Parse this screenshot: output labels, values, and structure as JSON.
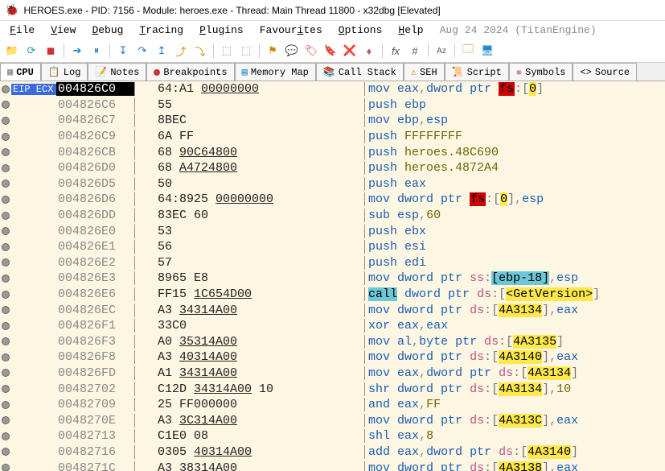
{
  "title": "HEROES.exe - PID: 7156 - Module: heroes.exe - Thread: Main Thread 11800 - x32dbg [Elevated]",
  "menu": {
    "file": "File",
    "view": "View",
    "debug": "Debug",
    "tracing": "Tracing",
    "plugins": "Plugins",
    "favourites": "Favourites",
    "options": "Options",
    "help": "Help",
    "date_info": "Aug 24 2024 (TitanEngine)"
  },
  "tabs": {
    "cpu": "CPU",
    "log": "Log",
    "notes": "Notes",
    "breakpoints": "Breakpoints",
    "memory_map": "Memory Map",
    "call_stack": "Call Stack",
    "seh": "SEH",
    "script": "Script",
    "symbols": "Symbols",
    "source": "Source"
  },
  "eip_label": "EIP ECX",
  "rows": [
    {
      "eip": true,
      "addr": "004826C0",
      "bytes_pre": "64:A1 ",
      "bytes_u": "00000000",
      "disasm_html": "<span class='mn'>mov</span> <span class='reg'>eax</span><span class='gray'>,</span><span class='mn'>dword ptr</span> <span class='seg-fs'>fs</span><span class='bracket'>:</span><span class='bracket'>[</span><span class='br-y'>0</span><span class='bracket'>]</span>"
    },
    {
      "addr": "004826C6",
      "bytes_pre": "55",
      "disasm_html": "<span class='mn'>push</span> <span class='reg'>ebp</span>"
    },
    {
      "addr": "004826C7",
      "bytes_pre": "8BEC",
      "disasm_html": "<span class='mn'>mov</span> <span class='reg'>ebp</span><span class='gray'>,</span><span class='reg'>esp</span>"
    },
    {
      "addr": "004826C9",
      "bytes_pre": "6A FF",
      "disasm_html": "<span class='mn'>push</span> <span class='num'>FFFFFFFF</span>"
    },
    {
      "addr": "004826CB",
      "bytes_pre": "68 ",
      "bytes_u": "90C64800",
      "disasm_html": "<span class='mn'>push</span> <span class='num'>heroes.48C690</span>"
    },
    {
      "addr": "004826D0",
      "bytes_pre": "68 ",
      "bytes_u": "A4724800",
      "disasm_html": "<span class='mn'>push</span> <span class='num'>heroes.4872A4</span>"
    },
    {
      "addr": "004826D5",
      "bytes_pre": "50",
      "disasm_html": "<span class='mn'>push</span> <span class='reg'>eax</span>"
    },
    {
      "addr": "004826D6",
      "bytes_pre": "64:8925 ",
      "bytes_u": "00000000",
      "disasm_html": "<span class='mn'>mov</span> <span class='mn'>dword ptr</span> <span class='seg-fs'>fs</span><span class='bracket'>:</span><span class='bracket'>[</span><span class='br-y'>0</span><span class='bracket'>]</span><span class='gray'>,</span><span class='reg'>esp</span>"
    },
    {
      "addr": "004826DD",
      "bytes_pre": "83EC 60",
      "disasm_html": "<span class='mn'>sub</span> <span class='reg'>esp</span><span class='gray'>,</span><span class='num'>60</span>"
    },
    {
      "addr": "004826E0",
      "bytes_pre": "53",
      "disasm_html": "<span class='mn'>push</span> <span class='reg'>ebx</span>"
    },
    {
      "addr": "004826E1",
      "bytes_pre": "56",
      "disasm_html": "<span class='mn'>push</span> <span class='reg'>esi</span>"
    },
    {
      "addr": "004826E2",
      "bytes_pre": "57",
      "disasm_html": "<span class='mn'>push</span> <span class='reg'>edi</span>"
    },
    {
      "addr": "004826E3",
      "bytes_pre": "8965 E8",
      "disasm_html": "<span class='mn'>mov</span> <span class='mn'>dword ptr</span> <span class='seg-ss'>ss</span><span class='bracket'>:</span><span class='call-bg'>[</span><span class='call-bg'>ebp-18</span><span class='call-bg'>]</span><span class='gray'>,</span><span class='reg'>esp</span>"
    },
    {
      "addr": "004826E6",
      "bytes_pre": "FF15 ",
      "bytes_u": "1C654D00",
      "disasm_html": "<span class='call-bg'>call</span> <span class='mn'>dword ptr</span> <span class='seg-ds'>ds</span><span class='bracket'>:</span><span class='bracket'>[</span><span class='ptr-hl'>&lt;GetVersion&gt;</span><span class='bracket'>]</span>"
    },
    {
      "addr": "004826EC",
      "bytes_pre": "A3 ",
      "bytes_u": "34314A00",
      "disasm_html": "<span class='mn'>mov</span> <span class='mn'>dword ptr</span> <span class='seg-ds'>ds</span><span class='bracket'>:</span><span class='bracket'>[</span><span class='ptr-hl'>4A3134</span><span class='bracket'>]</span><span class='gray'>,</span><span class='reg'>eax</span>"
    },
    {
      "addr": "004826F1",
      "bytes_pre": "33C0",
      "disasm_html": "<span class='mn'>xor</span> <span class='reg'>eax</span><span class='gray'>,</span><span class='reg'>eax</span>"
    },
    {
      "addr": "004826F3",
      "bytes_pre": "A0 ",
      "bytes_u": "35314A00",
      "disasm_html": "<span class='mn'>mov</span> <span class='reg'>al</span><span class='gray'>,</span><span class='mn'>byte ptr</span> <span class='seg-ds'>ds</span><span class='bracket'>:</span><span class='bracket'>[</span><span class='ptr-hl'>4A3135</span><span class='bracket'>]</span>"
    },
    {
      "addr": "004826F8",
      "bytes_pre": "A3 ",
      "bytes_u": "40314A00",
      "disasm_html": "<span class='mn'>mov</span> <span class='mn'>dword ptr</span> <span class='seg-ds'>ds</span><span class='bracket'>:</span><span class='bracket'>[</span><span class='ptr-hl'>4A3140</span><span class='bracket'>]</span><span class='gray'>,</span><span class='reg'>eax</span>"
    },
    {
      "addr": "004826FD",
      "bytes_pre": "A1 ",
      "bytes_u": "34314A00",
      "disasm_html": "<span class='mn'>mov</span> <span class='reg'>eax</span><span class='gray'>,</span><span class='mn'>dword ptr</span> <span class='seg-ds'>ds</span><span class='bracket'>:</span><span class='bracket'>[</span><span class='ptr-hl'>4A3134</span><span class='bracket'>]</span>"
    },
    {
      "addr": "00482702",
      "bytes_pre": "C12D ",
      "bytes_u": "34314A00",
      "bytes_post": " 10",
      "disasm_html": "<span class='mn'>shr</span> <span class='mn'>dword ptr</span> <span class='seg-ds'>ds</span><span class='bracket'>:</span><span class='bracket'>[</span><span class='ptr-hl'>4A3134</span><span class='bracket'>]</span><span class='gray'>,</span><span class='num'>10</span>"
    },
    {
      "addr": "00482709",
      "bytes_pre": "25 FF000000",
      "disasm_html": "<span class='mn'>and</span> <span class='reg'>eax</span><span class='gray'>,</span><span class='num'>FF</span>"
    },
    {
      "addr": "0048270E",
      "bytes_pre": "A3 ",
      "bytes_u": "3C314A00",
      "disasm_html": "<span class='mn'>mov</span> <span class='mn'>dword ptr</span> <span class='seg-ds'>ds</span><span class='bracket'>:</span><span class='bracket'>[</span><span class='ptr-hl'>4A313C</span><span class='bracket'>]</span><span class='gray'>,</span><span class='reg'>eax</span>"
    },
    {
      "addr": "00482713",
      "bytes_pre": "C1E0 08",
      "disasm_html": "<span class='mn'>shl</span> <span class='reg'>eax</span><span class='gray'>,</span><span class='num'>8</span>"
    },
    {
      "addr": "00482716",
      "bytes_pre": "0305 ",
      "bytes_u": "40314A00",
      "disasm_html": "<span class='mn'>add</span> <span class='reg'>eax</span><span class='gray'>,</span><span class='mn'>dword ptr</span> <span class='seg-ds'>ds</span><span class='bracket'>:</span><span class='bracket'>[</span><span class='ptr-hl'>4A3140</span><span class='bracket'>]</span>"
    },
    {
      "addr": "0048271C",
      "bytes_pre": "A3 ",
      "bytes_u": "38314A00",
      "disasm_html": "<span class='mn'>mov</span> <span class='mn'>dword ptr</span> <span class='seg-ds'>ds</span><span class='bracket'>:</span><span class='bracket'>[</span><span class='ptr-hl'>4A3138</span><span class='bracket'>]</span><span class='gray'>,</span><span class='reg'>eax</span>"
    }
  ]
}
